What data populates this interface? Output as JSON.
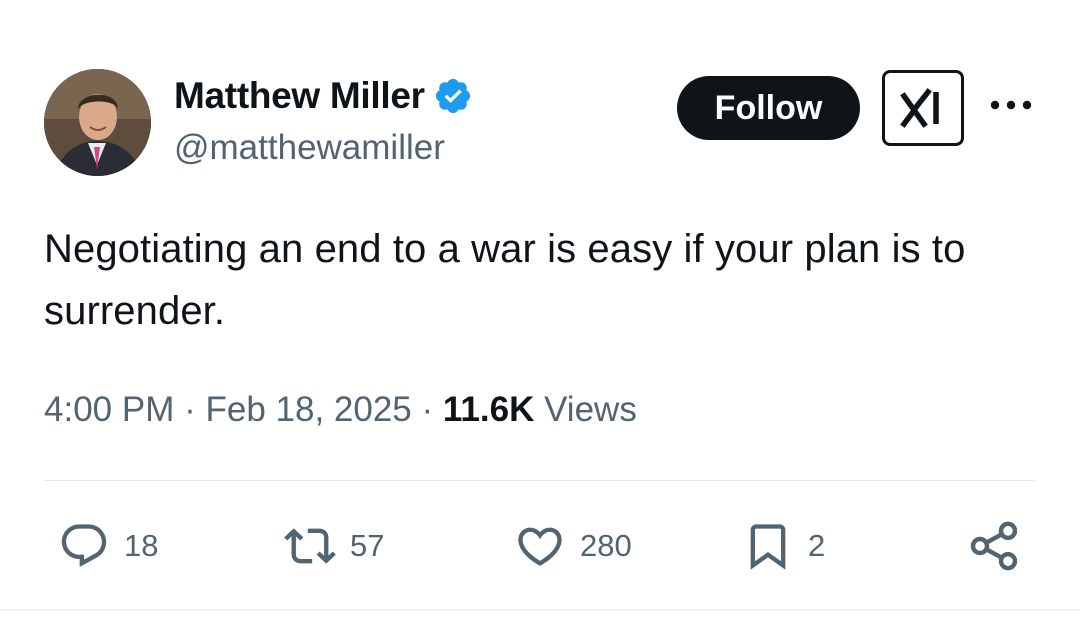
{
  "author": {
    "display_name": "Matthew Miller",
    "handle": "@matthewamiller",
    "verified": true
  },
  "header": {
    "follow_label": "Follow",
    "badge_icon": "xai-logo-icon",
    "more_icon": "more-dots-icon"
  },
  "tweet": {
    "text": "Negotiating an end to a war is easy if your plan is to surrender.",
    "time": "4:00 PM",
    "date": "Feb 18, 2025",
    "separator": "·",
    "views_count": "11.6K",
    "views_label": "Views"
  },
  "actions": {
    "replies": "18",
    "reposts": "57",
    "likes": "280",
    "bookmarks": "2"
  },
  "colors": {
    "text": "#0f1419",
    "secondary": "#536471",
    "verified": "#1d9bf0",
    "follow_bg": "#0f1419"
  }
}
